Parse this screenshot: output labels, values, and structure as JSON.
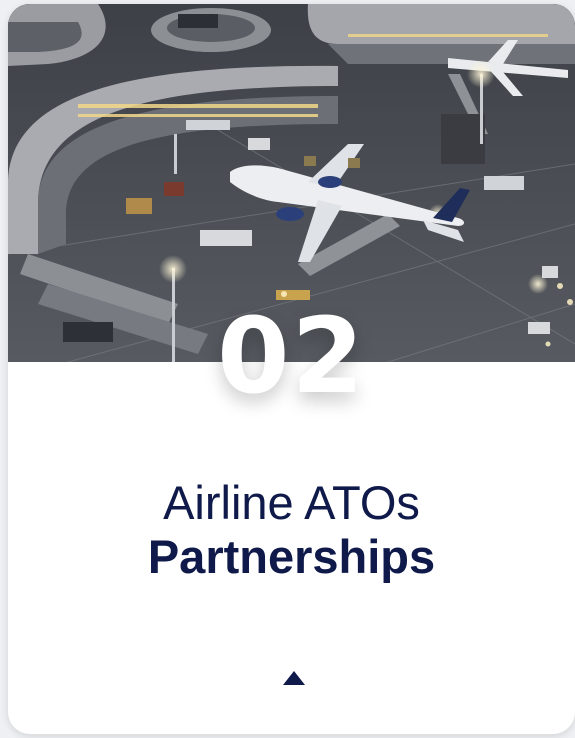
{
  "card": {
    "number": "02",
    "title_line1": "Airline ATOs",
    "title_line2": "Partnerships",
    "photo_subject": "airport-terminal-aerial",
    "toggle_icon": "caret-up-icon"
  },
  "colors": {
    "title": "#0f1a4a",
    "number": "#ffffff",
    "card_background": "#ffffff",
    "toggle": "#0f1a4a"
  }
}
